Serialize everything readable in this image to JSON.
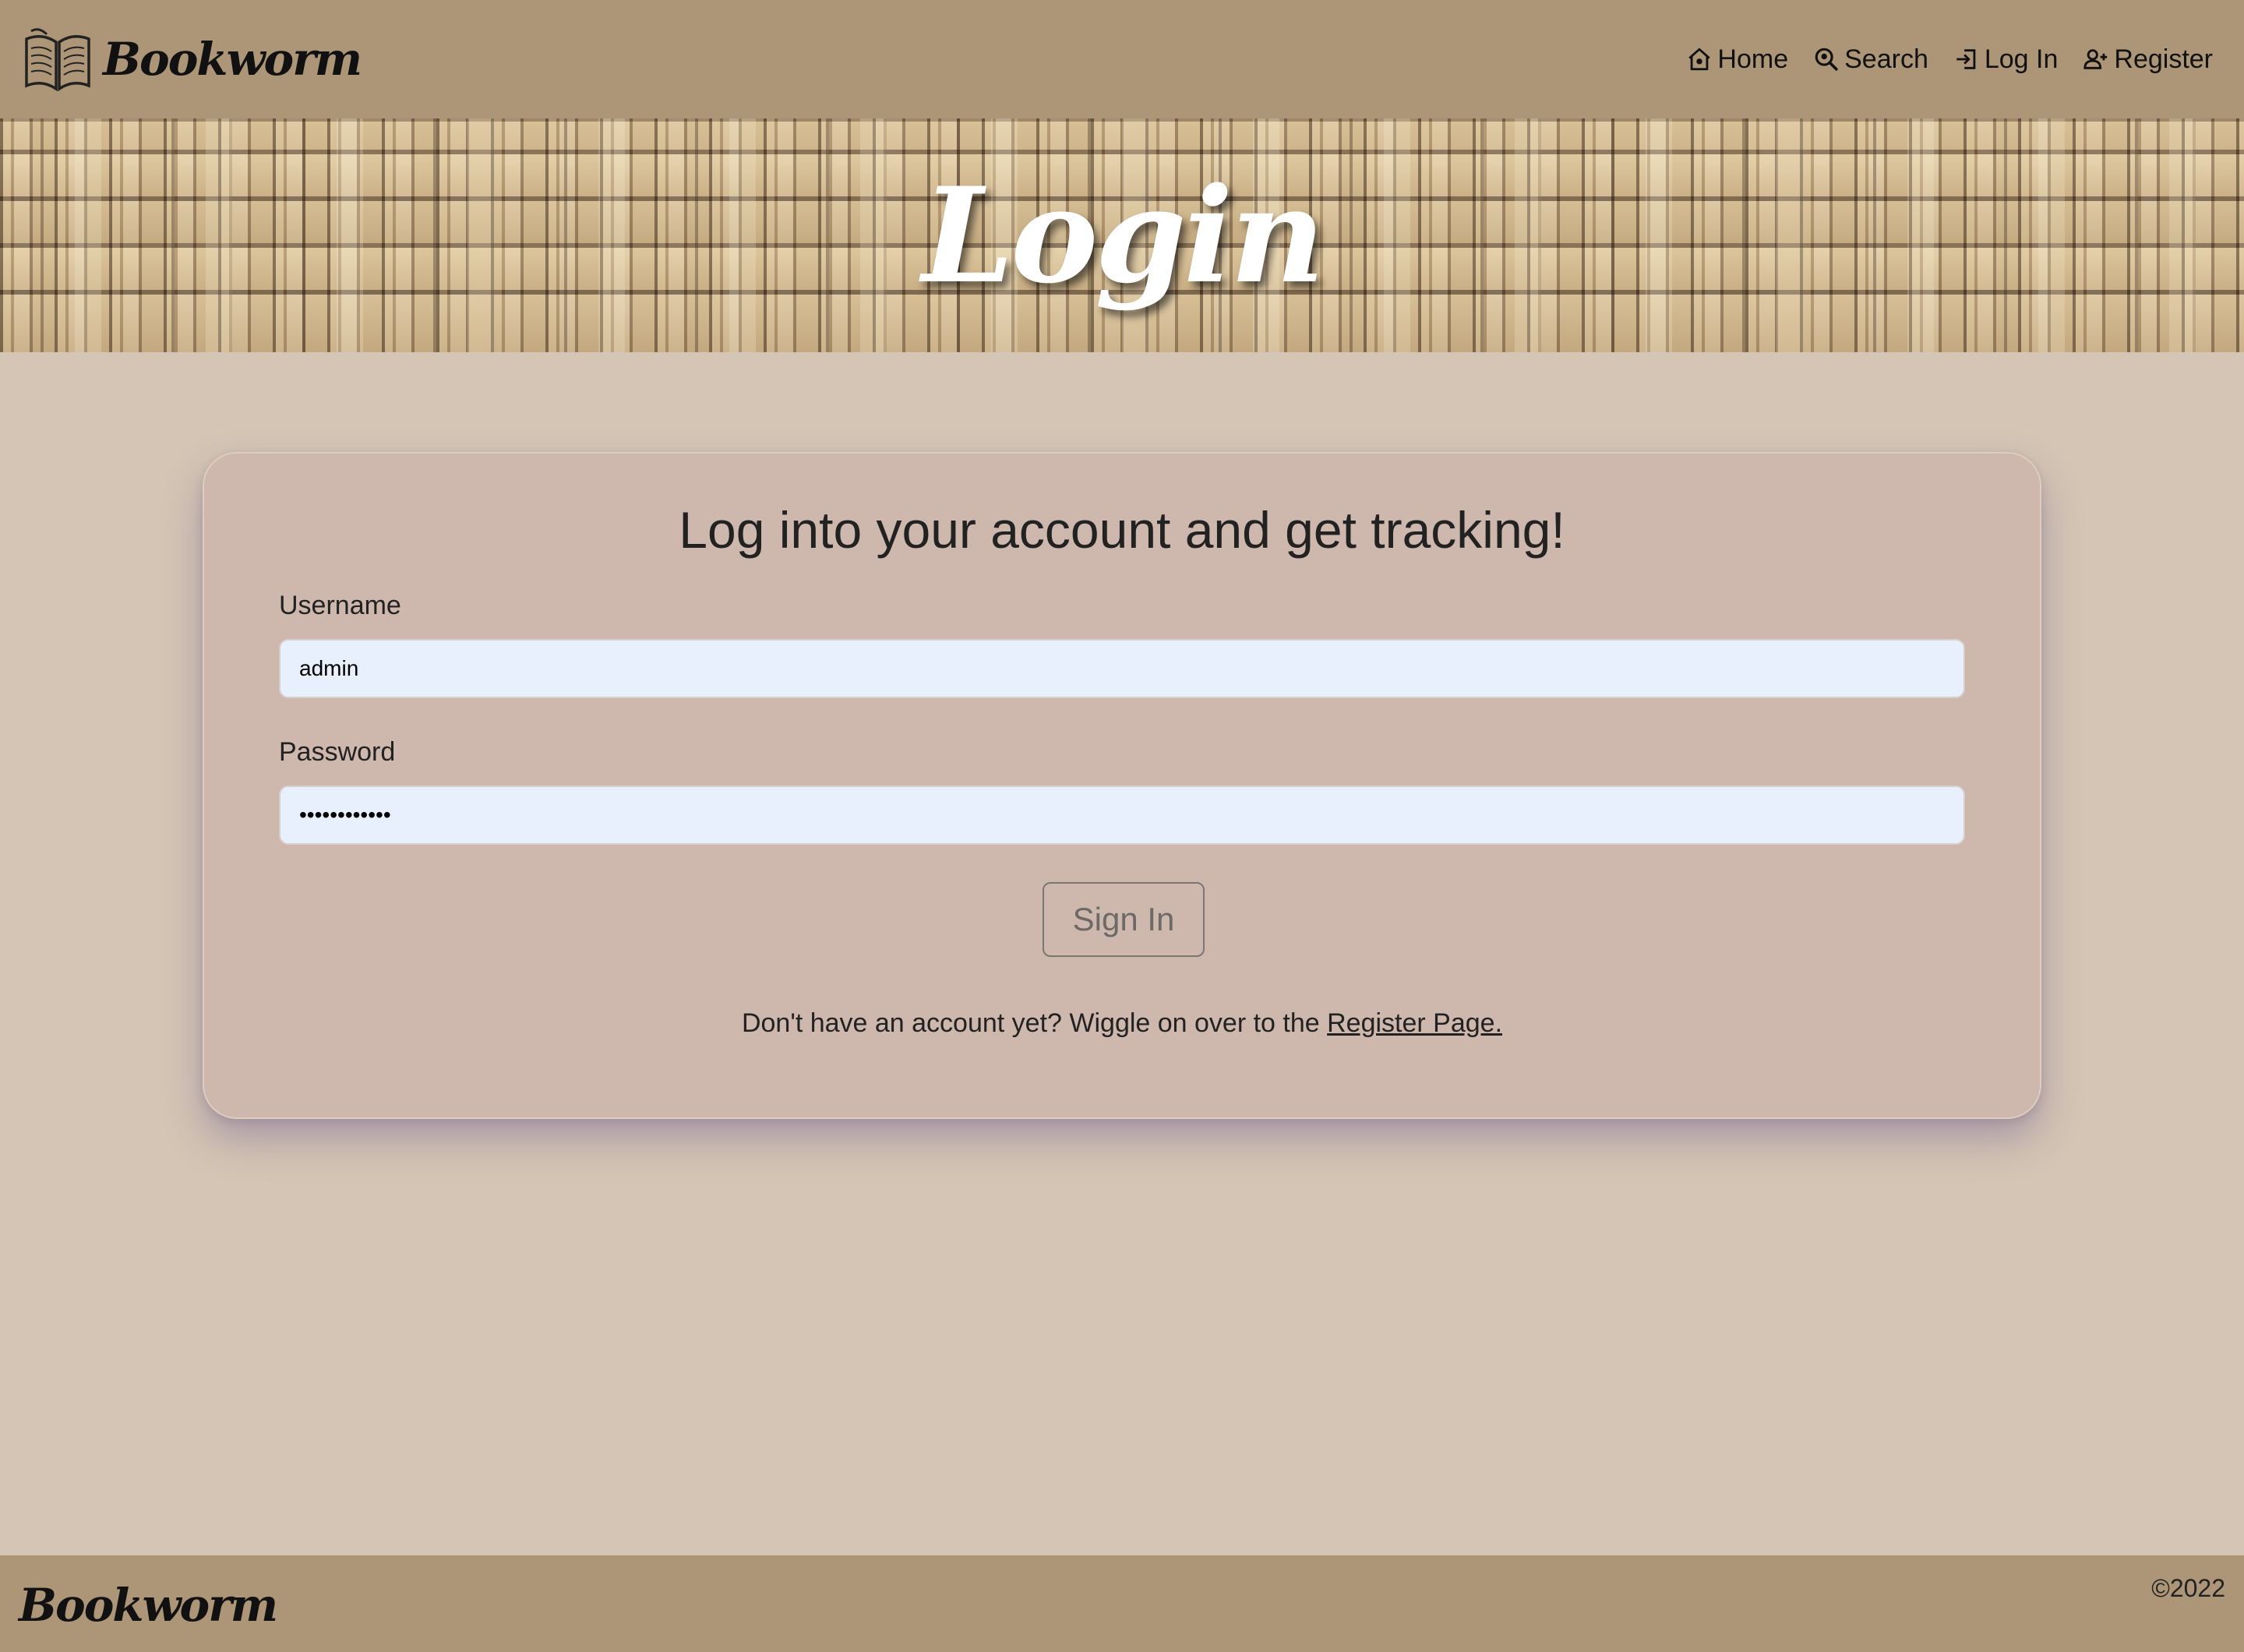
{
  "navbar": {
    "brand": "Bookworm",
    "brand_icon": "open-book-icon",
    "links": [
      {
        "label": "Home",
        "icon": "home-icon"
      },
      {
        "label": "Search",
        "icon": "search-icon"
      },
      {
        "label": "Log In",
        "icon": "login-icon"
      },
      {
        "label": "Register",
        "icon": "add-user-icon"
      }
    ]
  },
  "hero": {
    "title": "Login"
  },
  "login_form": {
    "heading": "Log into your account and get tracking!",
    "username_label": "Username",
    "username_value": "admin",
    "password_label": "Password",
    "password_value": "••••••••••••",
    "submit_label": "Sign In",
    "register_prompt": "Don't have an account yet? Wiggle on over to the ",
    "register_link": "Register Page."
  },
  "footer": {
    "brand": "Bookworm",
    "copyright": "©2022"
  },
  "colors": {
    "navbar_bg": "#ad9677",
    "page_bg": "#d4c5b4",
    "card_bg": "#ceb8ad",
    "input_bg": "#e8f0fe"
  }
}
